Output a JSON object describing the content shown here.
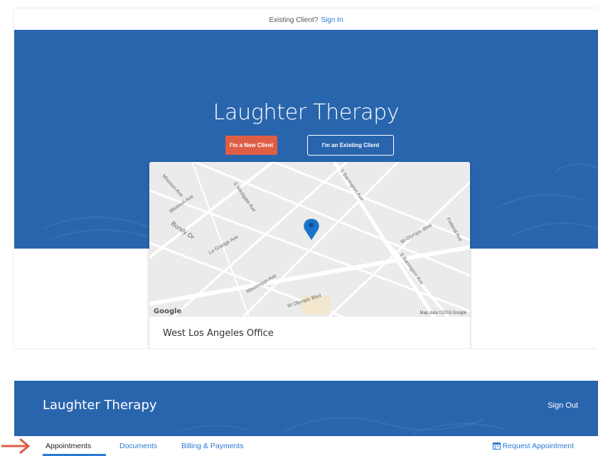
{
  "client_portal": {
    "topbar": {
      "prompt": "Existing Client?",
      "signin": "Sign In"
    },
    "hero": {
      "title": "Laughter Therapy"
    },
    "buttons": {
      "new_client": "I'm a New Client",
      "existing_client": "I'm an Existing Client"
    },
    "map": {
      "streets": [
        "Missouri Ave",
        "S Westgate Ave",
        "S Barrington Ave",
        "W Olympic Blvd",
        "Federal Ave",
        "Bundy Dr",
        "La Grange Ave",
        "Mississippi Ave",
        "W Olympic Blvd",
        "S Barrington Ave"
      ],
      "provider": "Google",
      "attribution": "Map data ©2019 Google"
    },
    "office": {
      "name": "West Los Angeles Office"
    }
  },
  "dashboard": {
    "header": {
      "title": "Laughter Therapy",
      "signout": "Sign Out"
    },
    "tabs": [
      "Appointments",
      "Documents",
      "Billing & Payments"
    ],
    "active_tab": "Appointments",
    "request_appointment": "Request Appointment"
  },
  "colors": {
    "brand_blue": "#2965ad",
    "accent_orange": "#e05d45",
    "link_blue": "#2a7ad5",
    "pin_blue": "#1a73c8"
  },
  "icons": [
    "map-pin-icon",
    "calendar-icon",
    "arrow-right-icon"
  ]
}
